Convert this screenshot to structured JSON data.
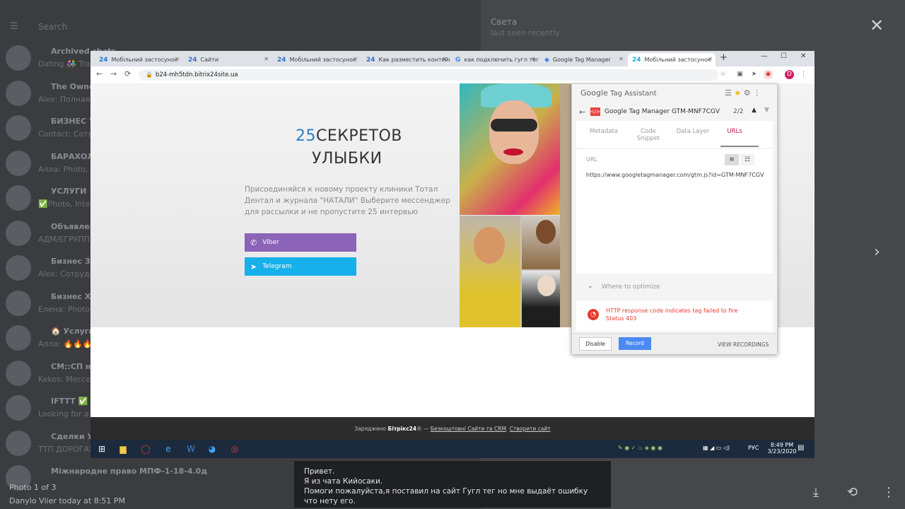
{
  "telegram": {
    "search_placeholder": "Search",
    "chats": [
      {
        "title": "Archived chats",
        "sub": "Dating 👫 Trav..."
      },
      {
        "title": "The Owner",
        "sub": "Alex: Полная..."
      },
      {
        "title": "БИЗНЕС УС...",
        "sub": "Сontact: Сотр..."
      },
      {
        "title": "БАРАХОЛК...",
        "sub": "Алла: Photo, в..."
      },
      {
        "title": "УСЛУГИ 🔥",
        "sub": "✅Photo, Interi..."
      },
      {
        "title": "Объявлени...",
        "sub": "АДМ/ЕГРУПП..."
      },
      {
        "title": "Бизнес Зак...",
        "sub": "Alex: Сотрудн..."
      },
      {
        "title": "Бизнес Хар...",
        "sub": "Елена: Photo, ..."
      },
      {
        "title": "🏠 Услуги ...",
        "sub": "Алла: 🔥🔥🔥..."
      },
      {
        "title": "СМ::СП неті...",
        "sub": "Kekos: Мессен..."
      },
      {
        "title": "IFTTT ✅",
        "sub": "Looking for a f..."
      },
      {
        "title": "Сделки Укр...",
        "sub": "ТТП ДОРОГАЯ..."
      },
      {
        "title": "Міжнародне право МПФ-1-18-4.0д",
        "sub": ""
      }
    ],
    "right_title": "Света",
    "right_sub": "last seen recently",
    "photo_counter": "Photo 1 of 3",
    "photo_author": "Danylo Vlier   today at 8:51 PM",
    "caption_lines": [
      "Привет.",
      "Я из чата Кийосаки.",
      "Помоги пожалуйста,я поставил на сайт Гугл тег но мне выдаёт ошибку что нету его."
    ]
  },
  "browser": {
    "tabs": [
      {
        "icon": "24",
        "label": "Мобільний застосунок"
      },
      {
        "icon": "24",
        "label": "Сайти"
      },
      {
        "icon": "24",
        "label": "Мобільний застосунок"
      },
      {
        "icon": "24",
        "label": "Как разместить контейн..."
      },
      {
        "icon": "G",
        "label": "как подключить гугл тег..."
      },
      {
        "icon": "◆",
        "label": "Google Tag Manager"
      },
      {
        "icon": "24",
        "label": "Мобільний застосунок"
      }
    ],
    "url": "b24-mh5tdn.bitrix24site.ua",
    "profile_initial": "D"
  },
  "site": {
    "title_num": "25",
    "title_rest": "СЕКРЕТОВ",
    "title_line2": "УЛЫБКИ",
    "description": "Присоединяйся к новому проекту клиники Тотал Дентал и журнала \"НАТАЛИ\" Выберите мессенджер для рассылки и не пропустите 25 интервью",
    "viber_label": "Viber",
    "telegram_label": "Telegram",
    "footer_prefix": "Заряджено",
    "footer_brand": "Бітрікс24",
    "footer_link1": "Безкоштовні Сайти та CRM",
    "footer_link2": "Створити сайт"
  },
  "tag_assistant": {
    "brand": "Google",
    "product": "Tag Assistant",
    "container_title": "Google Tag Manager GTM-MNF7CGV",
    "count": "2/2",
    "tabs": [
      "Metadata",
      "Code Snippet",
      "Data Layer",
      "URLs"
    ],
    "active_tab": "URLs",
    "url_label": "URL",
    "url_value": "https://www.googletagmanager.com/gtm.js?id=GTM-MNF7CGV",
    "where_label": "Where to optimize",
    "error_line1": "HTTP response code indicates tag failed to fire",
    "error_line2": "Status 403",
    "disable_label": "Disable",
    "record_label": "Record",
    "recordings_label": "VIEW RECORDINGS"
  },
  "taskbar": {
    "lang": "РУС",
    "time": "8:49 PM",
    "date": "3/23/2020"
  }
}
